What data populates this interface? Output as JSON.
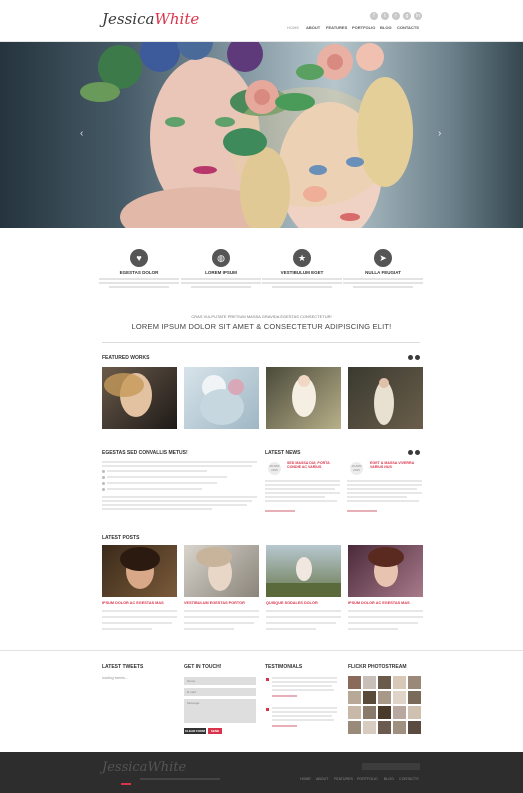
{
  "header": {
    "logo_part1": "Jessica",
    "logo_part2": "White",
    "nav": [
      "HOME",
      "ABOUT",
      "FEATURES",
      "PORTFOLIO",
      "BLOG",
      "CONTACTS"
    ],
    "social_icons": [
      "facebook-icon",
      "twitter-icon",
      "rss-icon",
      "google-icon",
      "linkedin-icon"
    ]
  },
  "features": [
    {
      "title": "EGESTAS DOLOR",
      "icon": "heart-icon"
    },
    {
      "title": "LOREM IPSUM",
      "icon": "globe-icon"
    },
    {
      "title": "VESTIBULUM EGET",
      "icon": "star-icon"
    },
    {
      "title": "NULLA FEUGIAT",
      "icon": "arrow-icon"
    }
  ],
  "tagline": {
    "sub": "CRAS VULPUTATE PRETIUM MASSA GRAVIDA EGESTAS CONSECTETUR!",
    "main": "LOREM IPSUM DOLOR SIT AMET & CONSECTETUR ADIPISCING ELIT!"
  },
  "sections": {
    "featured_works": "FEATURED WORKS",
    "egestas": "EGESTAS SED CONVALLIS METUS!",
    "latest_news": "LATEST NEWS",
    "latest_posts": "LATEST POSTS",
    "latest_tweets": "LATEST TWEETS",
    "get_in_touch": "GET IN TOUCH!",
    "testimonials": "TESTIMONIALS",
    "flickr": "FLICKR PHOTOSTREAM"
  },
  "news": [
    {
      "date": "28 APR 2015",
      "title": "SED MASSA DUI, PORTA CONDIE AC VARIUS"
    },
    {
      "date": "15 APR 2015",
      "title": "EGET & MASSA VIVERRA VARIUS NUS"
    }
  ],
  "posts": [
    {
      "title": "IPSUM DOLOR AC EGESTAS MAS"
    },
    {
      "title": "VESTIBULUM EGESTAS PORTOR"
    },
    {
      "title": "QUISQUE SODALES DOLOR"
    },
    {
      "title": "IPSUM DOLOR AC EGESTAS MAS"
    }
  ],
  "tweets": {
    "loading": "loading tweets..."
  },
  "form": {
    "name_placeholder": "Name:",
    "email_placeholder": "E-mail:",
    "message_placeholder": "Message:",
    "clear_label": "CLEAR FORM",
    "send_label": "SEND"
  },
  "footer": {
    "logo_part1": "Jessica",
    "logo_part2": "White",
    "nav": [
      "HOME",
      "ABOUT",
      "FEATURES",
      "PORTFOLIO",
      "BLOG",
      "CONTACTS"
    ]
  },
  "colors": {
    "accent": "#d9334a",
    "footer_bg": "#2d2d2d",
    "text": "#444444"
  }
}
